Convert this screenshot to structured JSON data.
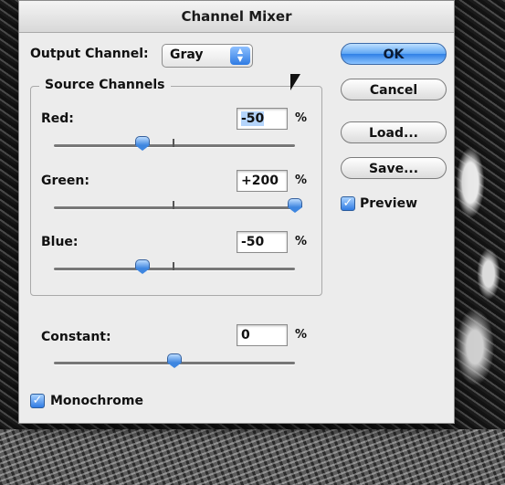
{
  "dialog": {
    "title": "Channel Mixer",
    "output_channel_label": "Output Channel:",
    "output_channel_value": "Gray",
    "source_channels": {
      "title": "Source Channels",
      "red": {
        "label": "Red:",
        "value": "-50",
        "unit": "%",
        "level_percent": -50
      },
      "green": {
        "label": "Green:",
        "value": "+200",
        "unit": "%",
        "level_percent": 200
      },
      "blue": {
        "label": "Blue:",
        "value": "-50",
        "unit": "%",
        "level_percent": -50
      }
    },
    "constant": {
      "label": "Constant:",
      "value": "0",
      "unit": "%",
      "level_percent": 0
    },
    "monochrome": {
      "label": "Monochrome",
      "checked": true
    },
    "buttons": {
      "ok": "OK",
      "cancel": "Cancel",
      "load": "Load...",
      "save": "Save..."
    },
    "preview": {
      "label": "Preview",
      "checked": true
    }
  },
  "icons": [
    "chevron-up-down-icon",
    "checkmark-icon",
    "mouse-pointer-icon"
  ],
  "colors": {
    "accent": "#2f7be3",
    "dialog_bg": "#ececec"
  }
}
